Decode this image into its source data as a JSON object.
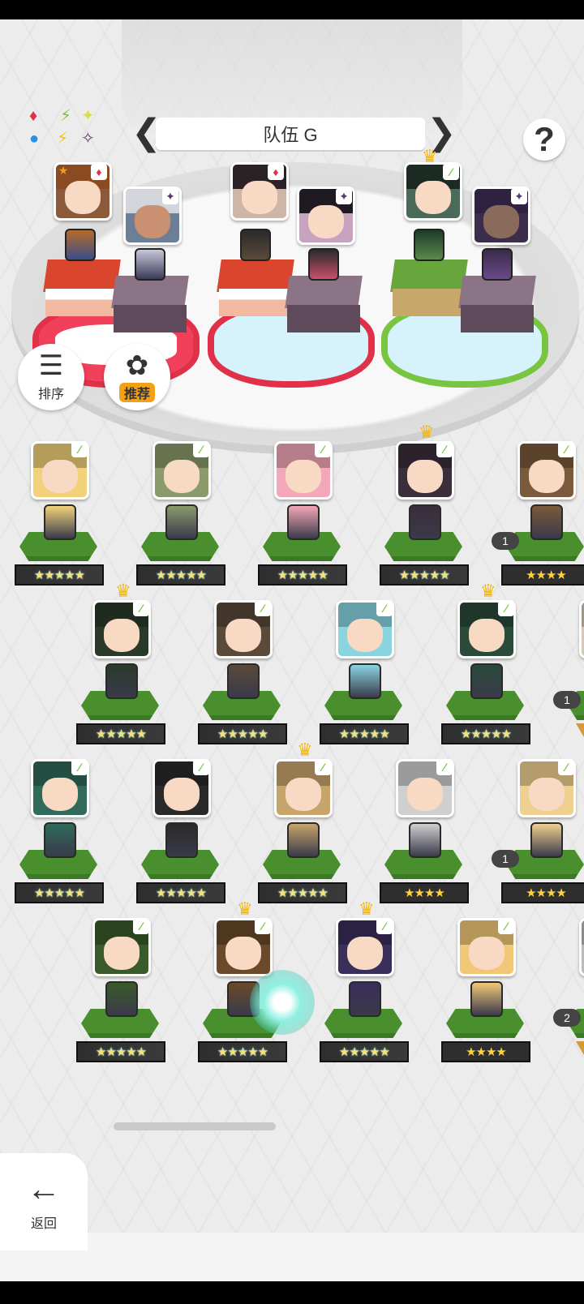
{
  "header": {
    "team_title": "队伍 G",
    "prev_arrow": "❮",
    "next_arrow": "❯",
    "help_label": "?"
  },
  "element_legend": [
    "♦",
    "⚡",
    "✦",
    "●",
    "✧",
    "▸"
  ],
  "side_buttons": {
    "sort_label": "排序",
    "recommend_label": "推荐"
  },
  "team_slots": [
    {
      "front_element": "♦",
      "back_element": "✦",
      "front_leader_star": "★"
    },
    {
      "front_element": "♦",
      "back_element": "✦"
    },
    {
      "front_element": "⁄",
      "back_element": "✦"
    }
  ],
  "roster": [
    {
      "stars": "★★★★★",
      "count": ""
    },
    {
      "stars": "★★★★★",
      "count": ""
    },
    {
      "stars": "★★★★★",
      "count": ""
    },
    {
      "stars": "★★★★★",
      "count": ""
    },
    {
      "stars": "★★★★",
      "count": "1"
    },
    {
      "stars": "★★★★★",
      "count": ""
    },
    {
      "stars": "★★★★★",
      "count": ""
    },
    {
      "stars": "★★★★★",
      "count": ""
    },
    {
      "stars": "★★★★★",
      "count": ""
    },
    {
      "stars": "",
      "count": "1"
    },
    {
      "stars": "★★★★★",
      "count": ""
    },
    {
      "stars": "★★★★★",
      "count": ""
    },
    {
      "stars": "★★★★★",
      "count": ""
    },
    {
      "stars": "★★★★",
      "count": ""
    },
    {
      "stars": "★★★★",
      "count": "1"
    },
    {
      "stars": "★★★★★",
      "count": ""
    },
    {
      "stars": "★★★★★",
      "count": ""
    },
    {
      "stars": "★★★★★",
      "count": ""
    },
    {
      "stars": "★★★★",
      "count": ""
    },
    {
      "stars": "",
      "count": "2"
    }
  ],
  "back_button": {
    "label": "返回",
    "icon": "arrow-left-icon"
  },
  "colors": {
    "fire_red": "#e03149",
    "nature_green": "#78c542",
    "crown_gold": "#f5b60d"
  }
}
